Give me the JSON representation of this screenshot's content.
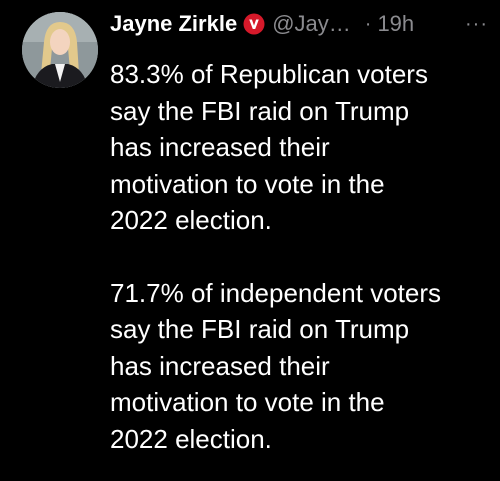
{
  "tweet": {
    "author": {
      "name": "Jayne Zirkle",
      "handle": "@Jay…",
      "verified_badge": "verified-badge-icon",
      "avatar": "avatar-photo"
    },
    "timestamp": "19h",
    "separator": "·",
    "more_label": "···",
    "paragraphs": [
      "83.3% of Republican voters\nsay the FBI raid on Trump\nhas increased their\nmotivation to vote in the\n2022 election.",
      "71.7% of independent voters\nsay the FBI raid on Trump\nhas increased their\nmotivation to vote in the\n2022 election."
    ]
  },
  "colors": {
    "background": "#000000",
    "text_primary": "#ffffff",
    "text_secondary": "#8b8b8f",
    "verified_badge": "#d6192a"
  }
}
